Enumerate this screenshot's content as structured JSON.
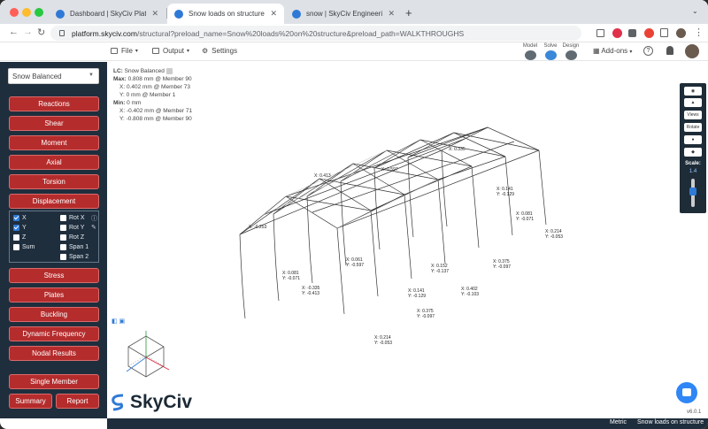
{
  "browser": {
    "tabs": [
      {
        "title": "Dashboard | SkyCiv Platform",
        "favicon_color": "#2f7ad6",
        "active": false
      },
      {
        "title": "Snow loads on structure | SkyCi",
        "favicon_color": "#2f7ad6",
        "active": true
      },
      {
        "title": "snow | SkyCiv Engineering",
        "favicon_color": "#2f7ad6",
        "active": false
      }
    ],
    "new_tab_glyph": "+",
    "url": {
      "host": "platform.skyciv.com",
      "path": "/structural?preload_name=Snow%20loads%20on%20structure&preload_path=WALKTHROUGHS"
    }
  },
  "app_menu": {
    "file": "File",
    "output": "Output",
    "settings": "Settings",
    "stages": [
      {
        "label": "Model",
        "color": "#606b73"
      },
      {
        "label": "Solve",
        "color": "#3a88d8"
      },
      {
        "label": "Design",
        "color": "#606b73"
      }
    ],
    "addons": "Add-ons",
    "help": "?"
  },
  "sidebar": {
    "dropdown_value": "Snow Balanced",
    "buttons": [
      "Reactions",
      "Shear",
      "Moment",
      "Axial",
      "Torsion",
      "Displacement"
    ],
    "displacement_options": [
      {
        "label": "X",
        "checked": true
      },
      {
        "label": "Y",
        "checked": true
      },
      {
        "label": "Z",
        "checked": false
      },
      {
        "label": "Sum",
        "checked": false
      },
      {
        "label": "Rot X",
        "checked": false
      },
      {
        "label": "Rot Y",
        "checked": false
      },
      {
        "label": "Rot Z",
        "checked": false
      },
      {
        "label": "Span 1",
        "checked": false
      },
      {
        "label": "Span 2",
        "checked": false
      }
    ],
    "buttons2": [
      "Stress",
      "Plates",
      "Buckling",
      "Dynamic Frequency",
      "Nodal Results"
    ],
    "single_member": "Single Member",
    "summary": "Summary",
    "report": "Report"
  },
  "results": {
    "lc_label": "LC:",
    "lc_name": "Snow Balanced",
    "max_label": "Max:",
    "max_x": "0.808 mm @ Member 90",
    "max_line2": "X: 0.402 mm @ Member 73",
    "max_line3": "Y: 0 mm @ Member 1",
    "min_label": "Min:",
    "min_x": "0 mm",
    "min_line2": "X: -0.402 mm @ Member 71",
    "min_line3": "Y: -0.808 mm @ Member 90"
  },
  "viewport_labels": [
    {
      "x": "X: 0.214",
      "y": "Y: -0.053"
    },
    {
      "x": "X: 0.375",
      "y": "Y: -0.097"
    },
    {
      "x": "X: 0.402",
      "y": "Y: -0.103"
    },
    {
      "x": "X: 0.152",
      "y": "Y: -0.137"
    },
    {
      "x": "X: 0.141",
      "y": "Y: -0.129"
    },
    {
      "x": "X: 0.081",
      "y": "Y: -0.071"
    },
    {
      "x": "X: 0.214",
      "y": "Y: -0.053"
    },
    {
      "x": "X: 0.375",
      "y": "Y: -0.097"
    },
    {
      "x": "X: 0.141",
      "y": "Y: -0.129"
    },
    {
      "x": "X: 0.061",
      "y": "Y: -0.597"
    },
    {
      "x": "X: -0.335",
      "y": "Y: -0.413"
    }
  ],
  "controls": {
    "views": "Views",
    "rotate": "Rotate",
    "scale_label": "Scale:",
    "scale_value": "1.4"
  },
  "logo_text": "SkyCiv",
  "version": "v6.0.1",
  "status": {
    "units": "Metric",
    "title": "Snow loads on structure"
  }
}
